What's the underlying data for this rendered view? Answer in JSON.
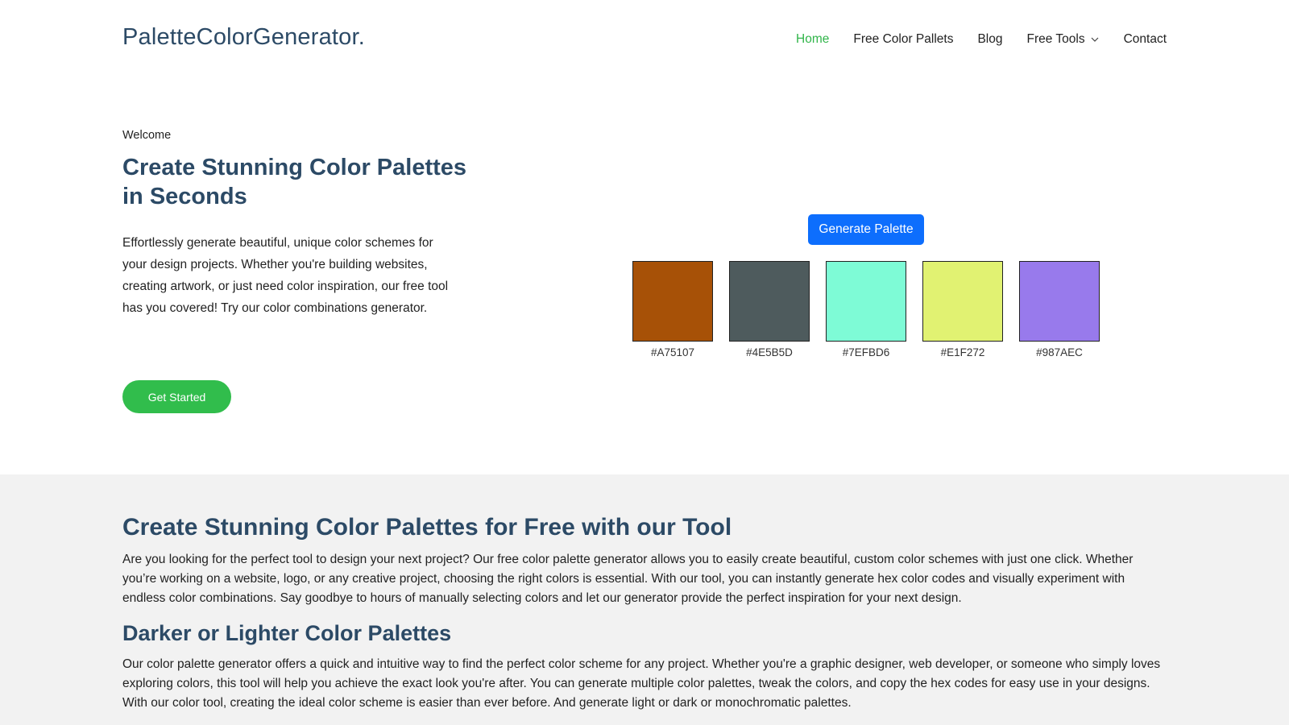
{
  "header": {
    "logo": "PaletteColorGenerator.",
    "nav": [
      {
        "label": "Home",
        "active": true
      },
      {
        "label": "Free Color Pallets"
      },
      {
        "label": "Blog"
      },
      {
        "label": "Free Tools",
        "dropdown": true
      },
      {
        "label": "Contact"
      }
    ]
  },
  "hero": {
    "welcome": "Welcome",
    "title_line1": "Create Stunning Color Palettes",
    "title_line2": "in Seconds",
    "text": "Effortlessly generate beautiful, unique color schemes for your design projects. Whether you're building websites, creating artwork, or just need color inspiration, our free tool has you covered! Try our color combinations generator.",
    "cta": "Get Started"
  },
  "generator": {
    "button": "Generate Palette",
    "swatches": [
      {
        "hex": "#A75107",
        "label": "#A75107"
      },
      {
        "hex": "#4E5B5D",
        "label": "#4E5B5D"
      },
      {
        "hex": "#7EFBD6",
        "label": "#7EFBD6"
      },
      {
        "hex": "#E1F272",
        "label": "#E1F272"
      },
      {
        "hex": "#987AEC",
        "label": "#987AEC"
      }
    ]
  },
  "info": {
    "h2": "Create Stunning Color Palettes for Free with our Tool",
    "p1": "Are you looking for the perfect tool to design your next project? Our free color palette generator allows you to easily create beautiful, custom color schemes with just one click. Whether you’re working on a website, logo, or any creative project, choosing the right colors is essential. With our tool, you can instantly generate hex color codes and visually experiment with endless color combinations. Say goodbye to hours of manually selecting colors and let our generator provide the perfect inspiration for your next design.",
    "h3": "Darker or Lighter Color Palettes",
    "p2": "Our color palette generator offers a quick and intuitive way to find the perfect color scheme for any project. Whether you're a graphic designer, web developer, or someone who simply loves exploring colors, this tool will help you achieve the exact look you're after. You can generate multiple color palettes, tweak the colors, and copy the hex codes for easy use in your designs. With our color tool, creating the ideal color scheme is easier than ever before. And generate light or dark or monochromatic palettes."
  },
  "colors": {
    "accent_green": "#31B54A",
    "button_blue": "#0D6EFD",
    "heading": "#2C4A66"
  }
}
